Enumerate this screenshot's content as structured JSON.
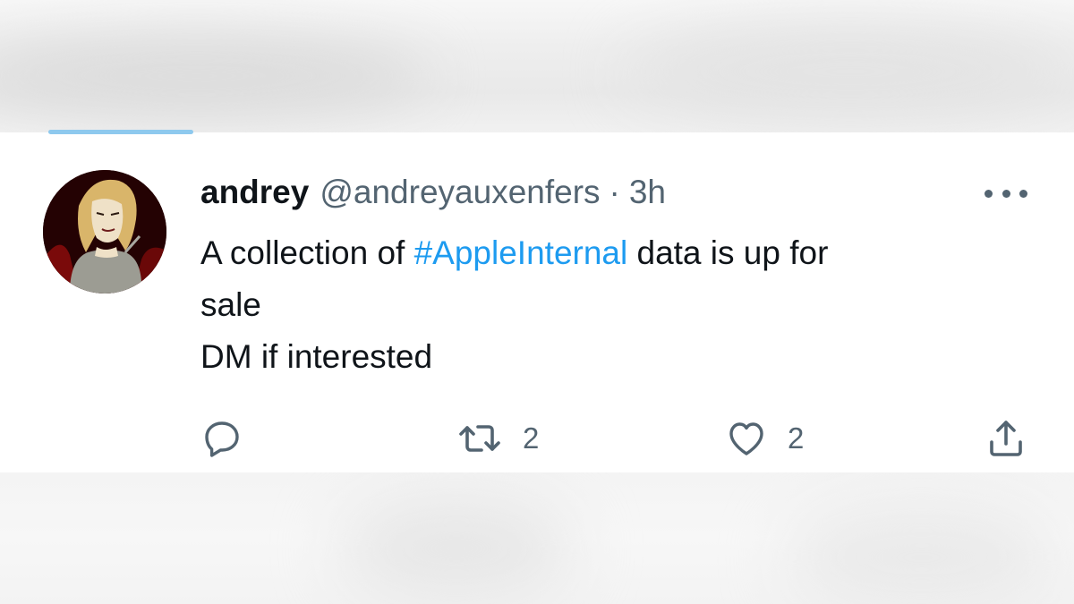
{
  "tweet": {
    "author_name": "andrey",
    "author_handle": "@andreyauxenfers",
    "separator": "·",
    "timestamp": "3h",
    "text_before_hashtag": "A collection of ",
    "hashtag": "#AppleInternal",
    "text_after_hashtag": " data is up for",
    "text_line2": "sale",
    "text_line3": "DM if interested",
    "retweet_count": "2",
    "like_count": "2"
  },
  "icons": {
    "reply": "reply-icon",
    "retweet": "retweet-icon",
    "like": "heart-icon",
    "share": "share-icon",
    "more": "more-options-icon"
  },
  "colors": {
    "text": "#0f1419",
    "secondary": "#536471",
    "hashtag": "#1d9bf0",
    "tab_indicator": "#8ec9ee"
  }
}
